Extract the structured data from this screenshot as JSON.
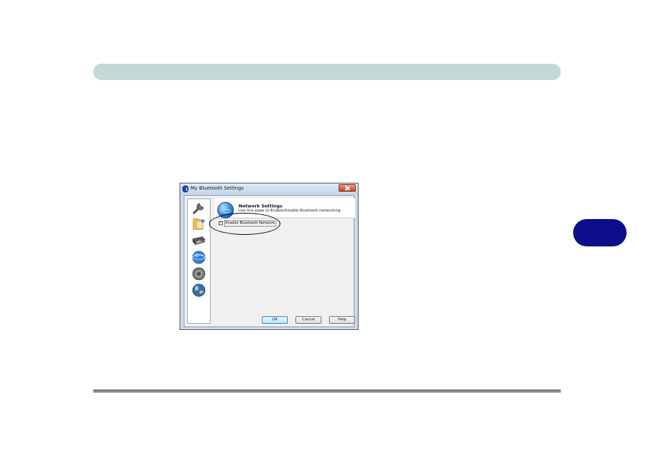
{
  "dialog": {
    "title": "My Bluetooth Settings",
    "panel": {
      "title": "Network Settings",
      "description": "Use this page to Enable/Disable Bluetooth networking."
    },
    "checkbox": {
      "label": "Enable Bluetooth Network",
      "checked": true,
      "mark": "✓"
    },
    "buttons": {
      "ok": "OK",
      "cancel": "Cancel",
      "help": "Help"
    },
    "sidebar_icons": [
      "wrench-icon",
      "folder-icon",
      "device-icon",
      "network-globe-icon",
      "speaker-icon",
      "earth-globe-icon"
    ]
  },
  "colors": {
    "header_bar": "#c3d9d6",
    "chapter_tab": "#0d0e8c",
    "highlight": "#000000"
  }
}
